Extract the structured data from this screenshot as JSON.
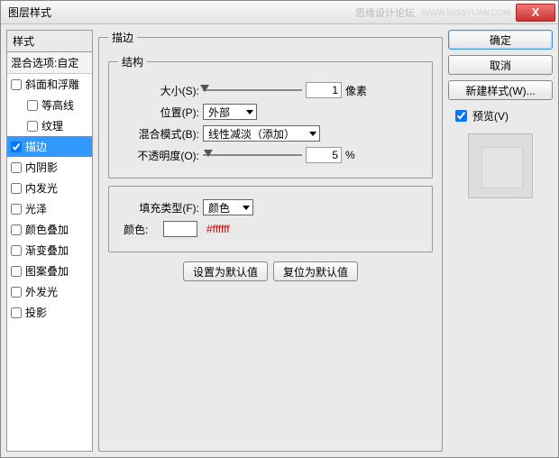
{
  "titlebar": {
    "title": "图层样式",
    "watermark": "思缘设计论坛",
    "watermark2": "WWW.MISSYUAN.COM",
    "close": "X"
  },
  "left": {
    "header": "样式",
    "blend_options": "混合选项:自定",
    "items": [
      {
        "label": "斜面和浮雕",
        "checked": false,
        "indent": false
      },
      {
        "label": "等高线",
        "checked": false,
        "indent": true
      },
      {
        "label": "纹理",
        "checked": false,
        "indent": true
      },
      {
        "label": "描边",
        "checked": true,
        "indent": false,
        "selected": true
      },
      {
        "label": "内阴影",
        "checked": false,
        "indent": false
      },
      {
        "label": "内发光",
        "checked": false,
        "indent": false
      },
      {
        "label": "光泽",
        "checked": false,
        "indent": false
      },
      {
        "label": "颜色叠加",
        "checked": false,
        "indent": false
      },
      {
        "label": "渐变叠加",
        "checked": false,
        "indent": false
      },
      {
        "label": "图案叠加",
        "checked": false,
        "indent": false
      },
      {
        "label": "外发光",
        "checked": false,
        "indent": false
      },
      {
        "label": "投影",
        "checked": false,
        "indent": false
      }
    ]
  },
  "center": {
    "outer_legend": "描边",
    "structure_legend": "结构",
    "size_label": "大小(S):",
    "size_value": "1",
    "size_unit": "像素",
    "position_label": "位置(P):",
    "position_value": "外部",
    "blendmode_label": "混合模式(B):",
    "blendmode_value": "线性减淡（添加）",
    "opacity_label": "不透明度(O):",
    "opacity_value": "5",
    "opacity_unit": "%",
    "fill_legend": "",
    "filltype_label": "填充类型(F):",
    "filltype_value": "颜色",
    "color_label": "颜色:",
    "color_hex": "#ffffff",
    "btn_default": "设置为默认值",
    "btn_reset": "复位为默认值"
  },
  "right": {
    "ok": "确定",
    "cancel": "取消",
    "newstyle": "新建样式(W)...",
    "preview_label": "预览(V)"
  }
}
